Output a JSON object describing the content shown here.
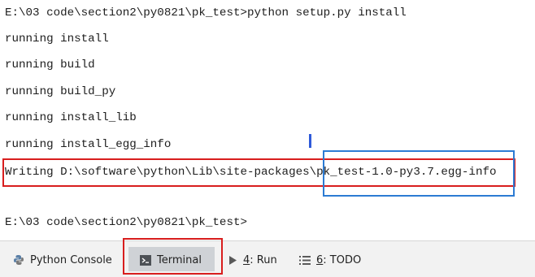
{
  "terminal": {
    "lines": [
      "E:\\03 code\\section2\\py0821\\pk_test>python setup.py install",
      "running install",
      "running build",
      "running build_py",
      "running install_lib",
      "running install_egg_info",
      "Writing D:\\software\\python\\Lib\\site-packages\\pk_test-1.0-py3.7.egg-info",
      "",
      "E:\\03 code\\section2\\py0821\\pk_test>"
    ]
  },
  "toolbar": {
    "python_console": {
      "label": "Python Console",
      "icon": "python-console-icon"
    },
    "terminal": {
      "label": "Terminal",
      "icon": "terminal-icon"
    },
    "run": {
      "mnemonic": "4",
      "label": ": Run",
      "icon": "run-icon"
    },
    "todo": {
      "mnemonic": "6",
      "label": ": TODO",
      "icon": "todo-icon"
    }
  },
  "colors": {
    "annotation_red": "#d81e1e",
    "annotation_blue": "#2c7bd3",
    "caret_blue": "#2f5ad9",
    "active_tab_bg": "#cfd2d6"
  }
}
